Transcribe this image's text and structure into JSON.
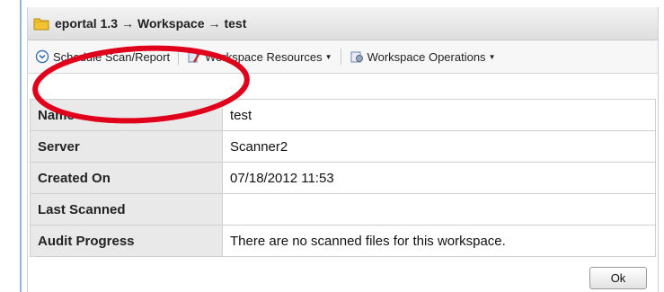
{
  "breadcrumb": {
    "items": [
      "eportal 1.3",
      "Workspace",
      "test"
    ],
    "separator": "→"
  },
  "toolbar": {
    "schedule_label": "Schedule Scan/Report",
    "resources_label": "Workspace Resources",
    "operations_label": "Workspace Operations"
  },
  "details": [
    {
      "label": "Name",
      "value": "test"
    },
    {
      "label": "Server",
      "value": "Scanner2"
    },
    {
      "label": "Created On",
      "value": "07/18/2012 11:53"
    },
    {
      "label": "Last Scanned",
      "value": ""
    },
    {
      "label": "Audit Progress",
      "value": "There are no scanned files for this workspace."
    }
  ],
  "footer": {
    "ok_label": "Ok"
  },
  "colors": {
    "annotation": "#e0001b",
    "folder": "#f2c230",
    "header_bg": "#e9e9e9"
  },
  "icons": [
    "folder-icon",
    "schedule-icon",
    "resources-icon",
    "operations-icon",
    "caret-down-icon"
  ]
}
